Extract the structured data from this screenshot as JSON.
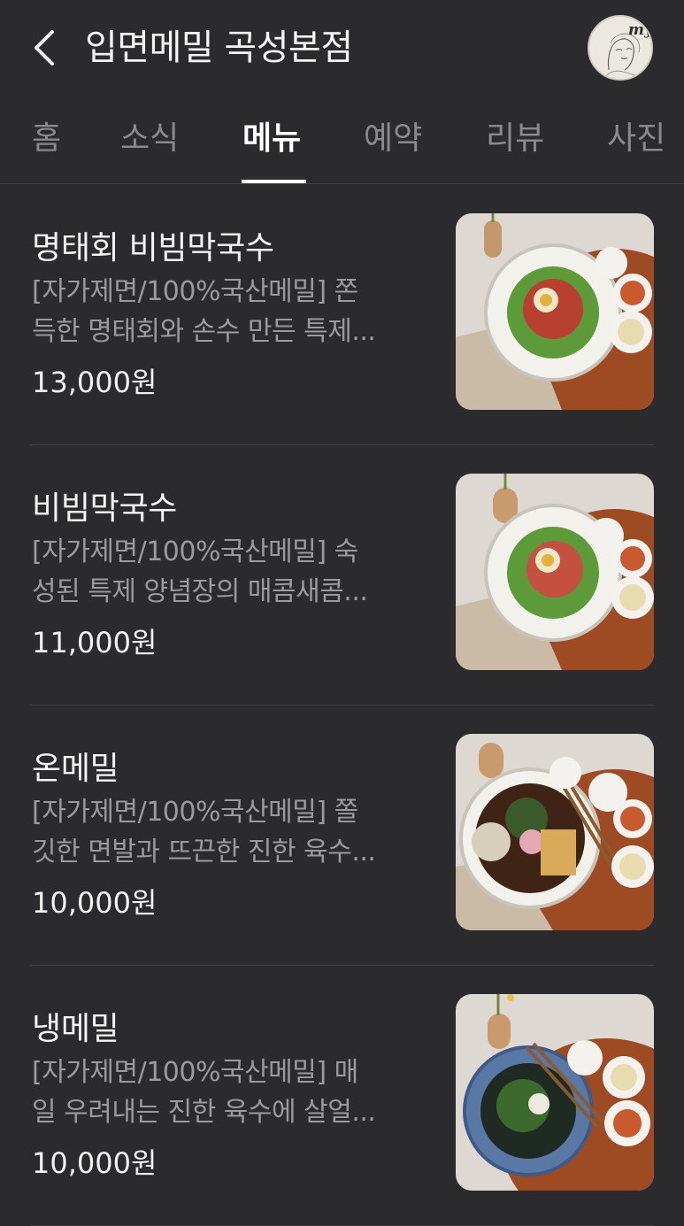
{
  "header": {
    "back_icon": "chevron-left-icon",
    "title": "입면메밀 곡성본점",
    "avatar_badge": "my"
  },
  "tabs": [
    {
      "label": "홈",
      "active": false
    },
    {
      "label": "소식",
      "active": false
    },
    {
      "label": "메뉴",
      "active": true
    },
    {
      "label": "예약",
      "active": false
    },
    {
      "label": "리뷰",
      "active": false
    },
    {
      "label": "사진",
      "active": false
    }
  ],
  "menu": {
    "items": [
      {
        "name": "명태회 비빔막국수",
        "desc_line1": "[자가제면/100%국산메밀] 쫀",
        "desc_line2": "득한 명태회와 손수 만든 특제...",
        "price": "13,000원",
        "photo": "bibim-pollock"
      },
      {
        "name": "비빔막국수",
        "desc_line1": "[자가제면/100%국산메밀] 숙",
        "desc_line2": "성된 특제 양념장의 매콤새콤...",
        "price": "11,000원",
        "photo": "bibim"
      },
      {
        "name": "온메밀",
        "desc_line1": "[자가제면/100%국산메밀] 쫄",
        "desc_line2": "깃한 면발과 뜨끈한 진한 육수...",
        "price": "10,000원",
        "photo": "hot-soba"
      },
      {
        "name": "냉메밀",
        "desc_line1": "[자가제면/100%국산메밀] 매",
        "desc_line2": "일 우려내는 진한 육수에 살얼...",
        "price": "10,000원",
        "photo": "cold-soba"
      }
    ]
  },
  "colors": {
    "background": "#2b2b2d",
    "text_primary": "#f4f4f4",
    "text_secondary": "#9b9b9d",
    "tab_inactive": "#8a8a8c",
    "divider": "#3e3e40"
  }
}
